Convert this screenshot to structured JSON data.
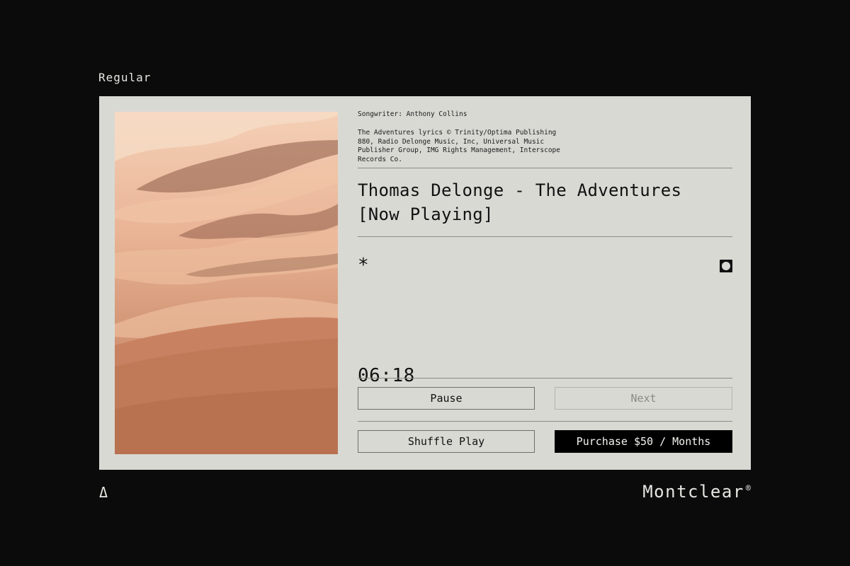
{
  "style_label": "Regular",
  "player": {
    "credits": {
      "songwriter": "Songwriter: Anthony Collins",
      "rights": "The Adventures lyrics © Trinity/Optima Publishing 880, Radio Delonge Music, Inc, Universal Music Publisher Group, IMG Rights Management, Interscope Records Co."
    },
    "title_line1": "Thomas Delonge - The Adventures",
    "title_line2": "[Now Playing]",
    "asterisk": "*",
    "time": "06:18",
    "buttons": {
      "pause": "Pause",
      "next": "Next",
      "shuffle": "Shuffle Play",
      "purchase": "Purchase $50 / Months"
    }
  },
  "footer": {
    "mark": "Δ",
    "brand": "Montclear",
    "brand_symbol": "®"
  },
  "colors": {
    "page_background": "#0b0b0b",
    "card_background": "#d9d9d4",
    "primary_button": "#000000"
  },
  "icons": [
    "asterisk-icon",
    "radio-circle-icon",
    "delta-icon"
  ]
}
